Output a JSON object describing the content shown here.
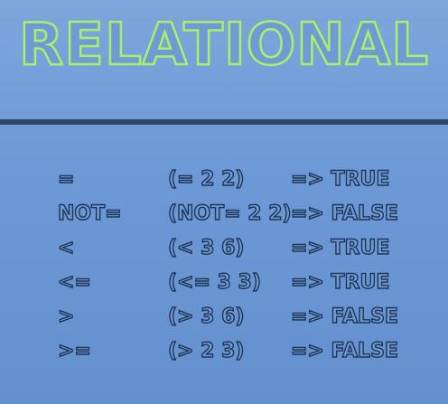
{
  "slide": {
    "title": "RELATIONAL",
    "rows": [
      {
        "op": "=",
        "expr": "(= 2 2)",
        "result": "=> TRUE"
      },
      {
        "op": "NOT=",
        "expr": "(NOT= 2 2)",
        "result": "=> FALSE"
      },
      {
        "op": "<",
        "expr": "(< 3 6)",
        "result": "=> TRUE"
      },
      {
        "op": "<=",
        "expr": "(<= 3 3)",
        "result": "=> TRUE"
      },
      {
        "op": ">",
        "expr": "(> 3 6)",
        "result": "=> FALSE"
      },
      {
        "op": ">=",
        "expr": "(> 2 3)",
        "result": "=> FALSE"
      }
    ]
  },
  "colors": {
    "background": "#6d99d6",
    "title_outline": "#a6f06a",
    "divider": "#2b4869",
    "text_outline": "#1e3553"
  }
}
